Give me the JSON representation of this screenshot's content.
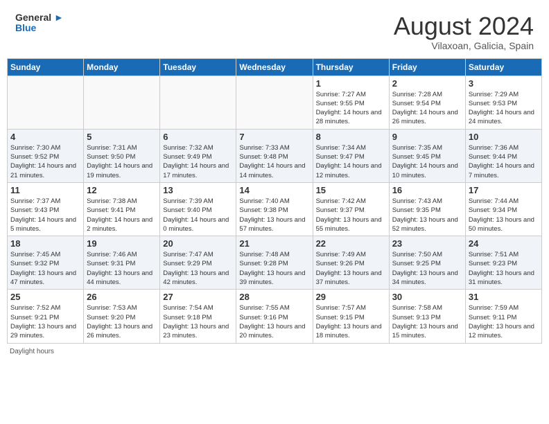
{
  "header": {
    "logo_general": "General",
    "logo_blue": "Blue",
    "month_year": "August 2024",
    "location": "Vilaxoan, Galicia, Spain"
  },
  "days_of_week": [
    "Sunday",
    "Monday",
    "Tuesday",
    "Wednesday",
    "Thursday",
    "Friday",
    "Saturday"
  ],
  "weeks": [
    [
      {
        "day": "",
        "info": ""
      },
      {
        "day": "",
        "info": ""
      },
      {
        "day": "",
        "info": ""
      },
      {
        "day": "",
        "info": ""
      },
      {
        "day": "1",
        "info": "Sunrise: 7:27 AM\nSunset: 9:55 PM\nDaylight: 14 hours and 28 minutes."
      },
      {
        "day": "2",
        "info": "Sunrise: 7:28 AM\nSunset: 9:54 PM\nDaylight: 14 hours and 26 minutes."
      },
      {
        "day": "3",
        "info": "Sunrise: 7:29 AM\nSunset: 9:53 PM\nDaylight: 14 hours and 24 minutes."
      }
    ],
    [
      {
        "day": "4",
        "info": "Sunrise: 7:30 AM\nSunset: 9:52 PM\nDaylight: 14 hours and 21 minutes."
      },
      {
        "day": "5",
        "info": "Sunrise: 7:31 AM\nSunset: 9:50 PM\nDaylight: 14 hours and 19 minutes."
      },
      {
        "day": "6",
        "info": "Sunrise: 7:32 AM\nSunset: 9:49 PM\nDaylight: 14 hours and 17 minutes."
      },
      {
        "day": "7",
        "info": "Sunrise: 7:33 AM\nSunset: 9:48 PM\nDaylight: 14 hours and 14 minutes."
      },
      {
        "day": "8",
        "info": "Sunrise: 7:34 AM\nSunset: 9:47 PM\nDaylight: 14 hours and 12 minutes."
      },
      {
        "day": "9",
        "info": "Sunrise: 7:35 AM\nSunset: 9:45 PM\nDaylight: 14 hours and 10 minutes."
      },
      {
        "day": "10",
        "info": "Sunrise: 7:36 AM\nSunset: 9:44 PM\nDaylight: 14 hours and 7 minutes."
      }
    ],
    [
      {
        "day": "11",
        "info": "Sunrise: 7:37 AM\nSunset: 9:43 PM\nDaylight: 14 hours and 5 minutes."
      },
      {
        "day": "12",
        "info": "Sunrise: 7:38 AM\nSunset: 9:41 PM\nDaylight: 14 hours and 2 minutes."
      },
      {
        "day": "13",
        "info": "Sunrise: 7:39 AM\nSunset: 9:40 PM\nDaylight: 14 hours and 0 minutes."
      },
      {
        "day": "14",
        "info": "Sunrise: 7:40 AM\nSunset: 9:38 PM\nDaylight: 13 hours and 57 minutes."
      },
      {
        "day": "15",
        "info": "Sunrise: 7:42 AM\nSunset: 9:37 PM\nDaylight: 13 hours and 55 minutes."
      },
      {
        "day": "16",
        "info": "Sunrise: 7:43 AM\nSunset: 9:35 PM\nDaylight: 13 hours and 52 minutes."
      },
      {
        "day": "17",
        "info": "Sunrise: 7:44 AM\nSunset: 9:34 PM\nDaylight: 13 hours and 50 minutes."
      }
    ],
    [
      {
        "day": "18",
        "info": "Sunrise: 7:45 AM\nSunset: 9:32 PM\nDaylight: 13 hours and 47 minutes."
      },
      {
        "day": "19",
        "info": "Sunrise: 7:46 AM\nSunset: 9:31 PM\nDaylight: 13 hours and 44 minutes."
      },
      {
        "day": "20",
        "info": "Sunrise: 7:47 AM\nSunset: 9:29 PM\nDaylight: 13 hours and 42 minutes."
      },
      {
        "day": "21",
        "info": "Sunrise: 7:48 AM\nSunset: 9:28 PM\nDaylight: 13 hours and 39 minutes."
      },
      {
        "day": "22",
        "info": "Sunrise: 7:49 AM\nSunset: 9:26 PM\nDaylight: 13 hours and 37 minutes."
      },
      {
        "day": "23",
        "info": "Sunrise: 7:50 AM\nSunset: 9:25 PM\nDaylight: 13 hours and 34 minutes."
      },
      {
        "day": "24",
        "info": "Sunrise: 7:51 AM\nSunset: 9:23 PM\nDaylight: 13 hours and 31 minutes."
      }
    ],
    [
      {
        "day": "25",
        "info": "Sunrise: 7:52 AM\nSunset: 9:21 PM\nDaylight: 13 hours and 29 minutes."
      },
      {
        "day": "26",
        "info": "Sunrise: 7:53 AM\nSunset: 9:20 PM\nDaylight: 13 hours and 26 minutes."
      },
      {
        "day": "27",
        "info": "Sunrise: 7:54 AM\nSunset: 9:18 PM\nDaylight: 13 hours and 23 minutes."
      },
      {
        "day": "28",
        "info": "Sunrise: 7:55 AM\nSunset: 9:16 PM\nDaylight: 13 hours and 20 minutes."
      },
      {
        "day": "29",
        "info": "Sunrise: 7:57 AM\nSunset: 9:15 PM\nDaylight: 13 hours and 18 minutes."
      },
      {
        "day": "30",
        "info": "Sunrise: 7:58 AM\nSunset: 9:13 PM\nDaylight: 13 hours and 15 minutes."
      },
      {
        "day": "31",
        "info": "Sunrise: 7:59 AM\nSunset: 9:11 PM\nDaylight: 13 hours and 12 minutes."
      }
    ]
  ],
  "footer_text": "Daylight hours"
}
